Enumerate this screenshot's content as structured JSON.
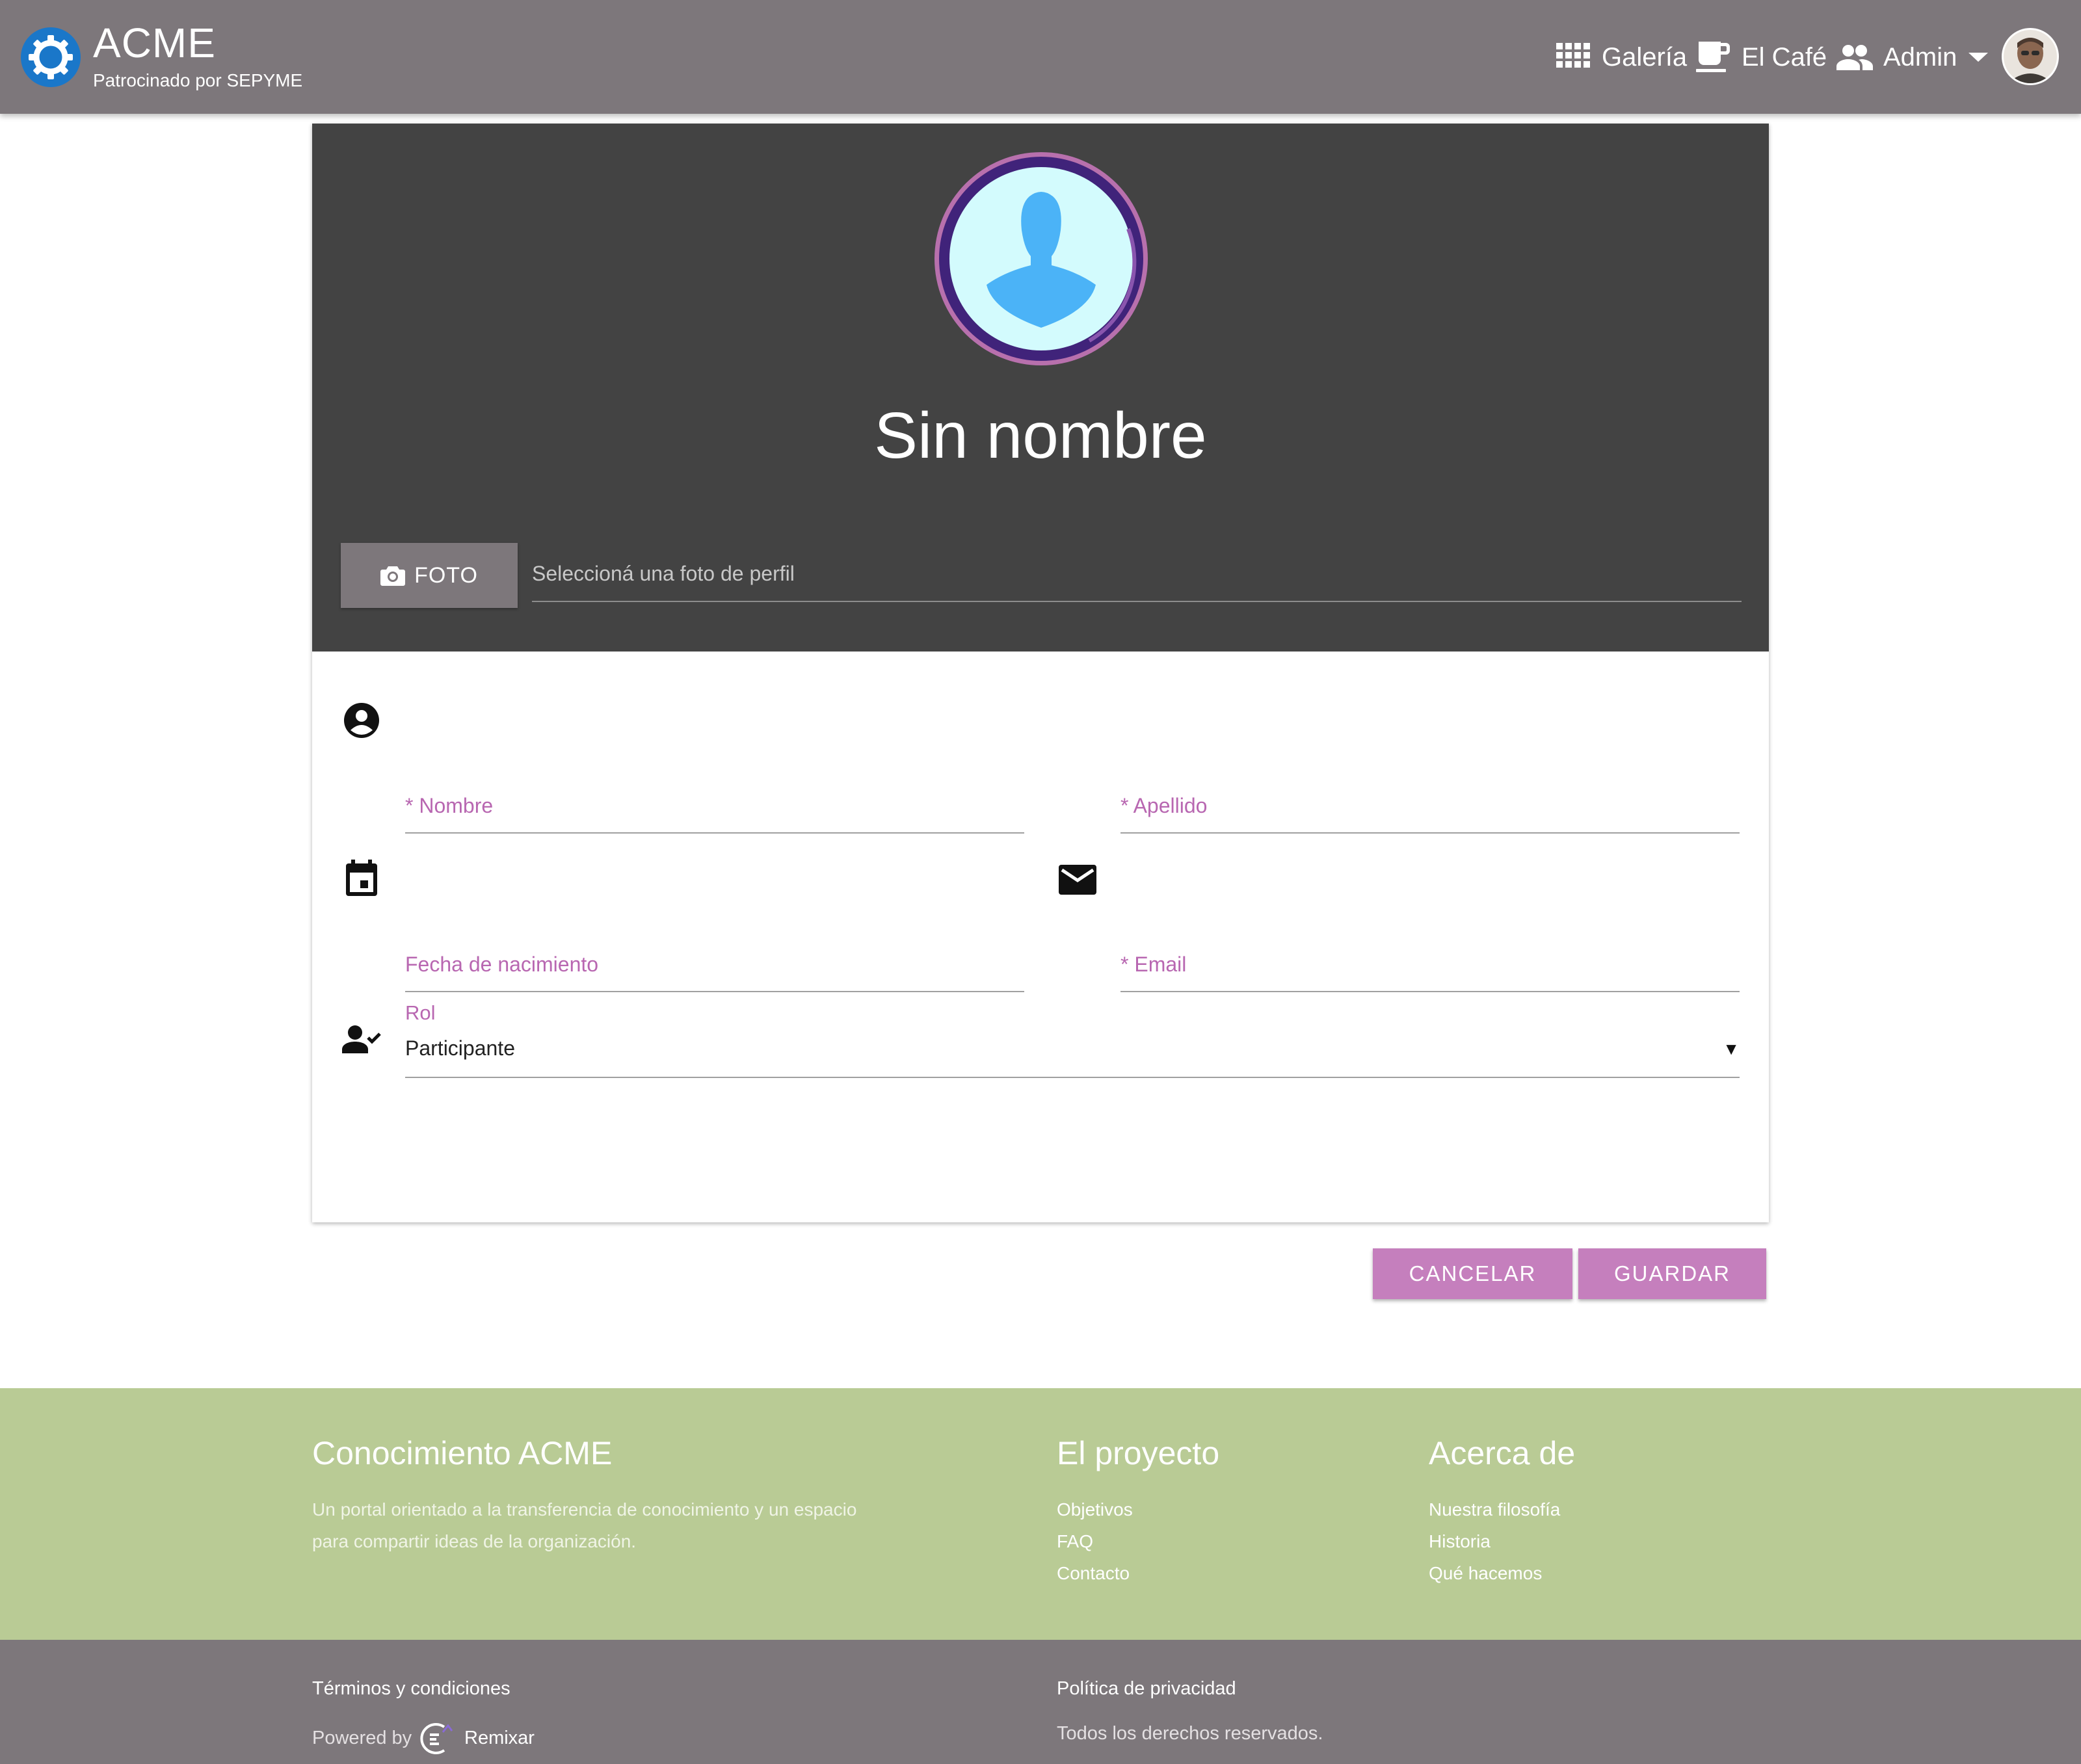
{
  "header": {
    "brand_title": "ACME",
    "brand_subtitle": "Patrocinado por SEPYME",
    "nav": {
      "gallery": "Galería",
      "cafe": "El Café",
      "admin": "Admin"
    },
    "icons": [
      "gear-logo-icon",
      "apps-grid-icon",
      "coffee-icon",
      "people-icon",
      "caret-down-icon"
    ],
    "colors": {
      "bar": "#7d777b",
      "logo": "#1a77c9"
    }
  },
  "profile": {
    "name": "Sin nombre",
    "photo_button": "FOTO",
    "photo_placeholder": "Seleccioná una foto de perfil"
  },
  "form": {
    "nombre_label": "* Nombre",
    "apellido_label": "* Apellido",
    "fecha_label": "Fecha de nacimiento",
    "email_label": "* Email",
    "rol_label": "Rol",
    "rol_value": "Participante",
    "rol_arrow": "▼"
  },
  "actions": {
    "cancel": "CANCELAR",
    "save": "GUARDAR",
    "accent_color": "#c57fbd"
  },
  "footer": {
    "col1_title": "Conocimiento ACME",
    "col1_text_line1": "Un portal orientado a la transferencia de conocimiento y un espacio",
    "col1_text_line2": "para compartir ideas de la organización.",
    "col2_title": "El proyecto",
    "col2_links": [
      "Objetivos",
      "FAQ",
      "Contacto"
    ],
    "col3_title": "Acerca de",
    "col3_links": [
      "Nuestra filosofía",
      "Historia",
      "Qué hacemos"
    ],
    "bg_color": "#b9cb95"
  },
  "bottom": {
    "terms": "Términos y condiciones",
    "privacy": "Política de privacidad",
    "powered_by": "Powered by",
    "remixar": "Remixar",
    "rights": "Todos los derechos reservados."
  }
}
